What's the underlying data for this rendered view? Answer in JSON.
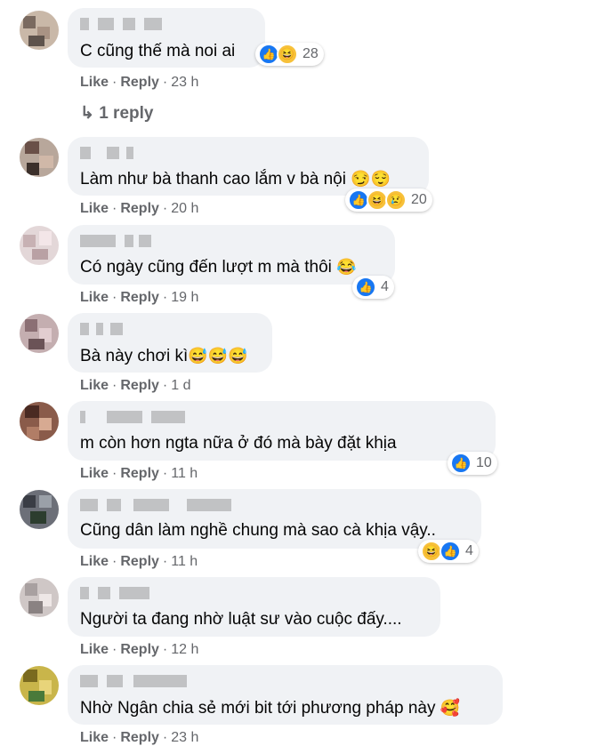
{
  "actions": {
    "like": "Like",
    "reply": "Reply",
    "dot": "·"
  },
  "comments": [
    {
      "text": "C cũng thế mà noi ai",
      "emojis": "",
      "reactions": {
        "count": "28",
        "icons": [
          "like",
          "haha"
        ]
      },
      "time": "23 h",
      "replies": "↳ 1 reply"
    },
    {
      "text": "Làm như bà thanh cao lắm v bà nội",
      "emojis": "😏😌",
      "reactions": {
        "count": "20",
        "icons": [
          "like",
          "haha",
          "sad"
        ]
      },
      "time": "20 h"
    },
    {
      "text": "Có ngày cũng đến lượt m mà thôi",
      "emojis": "😂",
      "reactions": {
        "count": "4",
        "icons": [
          "like"
        ]
      },
      "time": "19 h"
    },
    {
      "text": "Bà này chơi kì",
      "emojis": "😅😅😅",
      "time": "1 d"
    },
    {
      "text": "m còn      hơn ngta nữa ở đó mà bày đặt khịa",
      "emojis": "",
      "reactions": {
        "count": "10",
        "icons": [
          "like"
        ]
      },
      "time": "11 h"
    },
    {
      "text": "Cũng dân làm nghề chung mà sao cà khịa vậy..",
      "emojis": "",
      "reactions": {
        "count": "4",
        "icons": [
          "haha",
          "like"
        ]
      },
      "time": "11 h"
    },
    {
      "text": "Người ta đang nhờ luật sư vào cuộc đấy....",
      "emojis": "",
      "time": "12 h"
    },
    {
      "text": "Nhờ Ngân chia sẻ mới bit tới phương pháp này",
      "emojis": "🥰",
      "time": "23 h"
    }
  ],
  "colors": {
    "bubble": "#f0f2f5",
    "meta": "#65676b",
    "like_blue": "#1877f2",
    "haha_yellow": "#f7c13a"
  }
}
